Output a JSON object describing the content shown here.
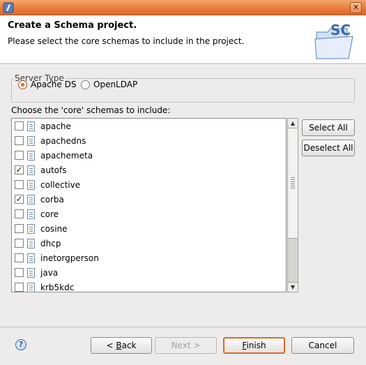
{
  "window": {
    "close_glyph": "✕"
  },
  "header": {
    "title": "Create a Schema project.",
    "description": "Please select the core schemas to include in the project.",
    "wizard_image_text": "SC"
  },
  "server_type": {
    "legend": "Server Type",
    "options": [
      {
        "label": "Apache DS",
        "selected": true
      },
      {
        "label": "OpenLDAP",
        "selected": false
      }
    ]
  },
  "schemas": {
    "label": "Choose the 'core' schemas to include:",
    "items": [
      {
        "name": "apache",
        "checked": false
      },
      {
        "name": "apachedns",
        "checked": false
      },
      {
        "name": "apachemeta",
        "checked": false
      },
      {
        "name": "autofs",
        "checked": true
      },
      {
        "name": "collective",
        "checked": false
      },
      {
        "name": "corba",
        "checked": true
      },
      {
        "name": "core",
        "checked": false
      },
      {
        "name": "cosine",
        "checked": false
      },
      {
        "name": "dhcp",
        "checked": false
      },
      {
        "name": "inetorgperson",
        "checked": false
      },
      {
        "name": "java",
        "checked": false
      },
      {
        "name": "krb5kdc",
        "checked": false
      }
    ],
    "select_all": "Select All",
    "deselect_all": "Deselect All"
  },
  "footer": {
    "help_glyph": "?",
    "back": {
      "prefix": "< ",
      "mnemonic": "B",
      "rest": "ack"
    },
    "next": "Next >",
    "finish": {
      "mnemonic": "F",
      "rest": "inish"
    },
    "cancel": "Cancel"
  },
  "colors": {
    "accent": "#d9692c",
    "titlebar": "#e87d3e",
    "dialog_bg": "#edeceb"
  }
}
